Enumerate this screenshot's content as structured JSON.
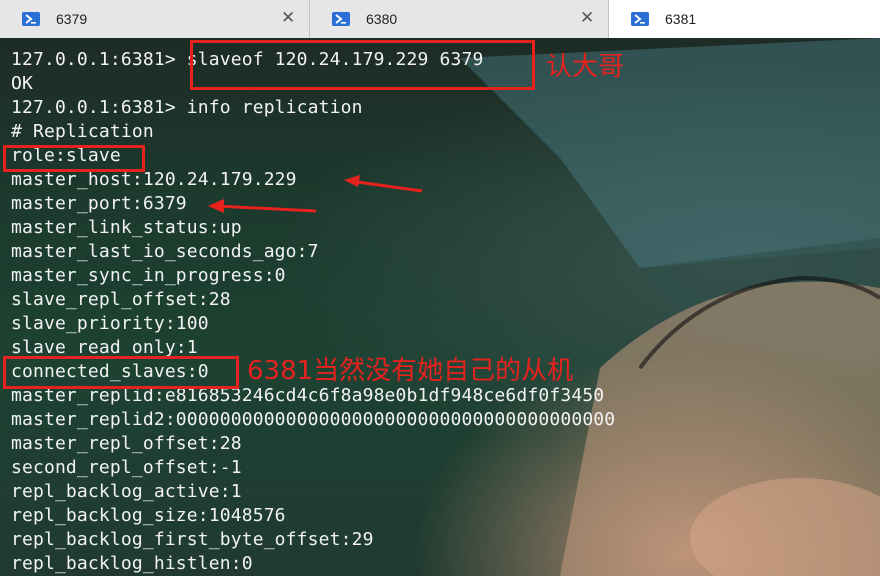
{
  "tabs": [
    {
      "label": "6379",
      "icon": "powershell-icon",
      "active": false
    },
    {
      "label": "6380",
      "icon": "powershell-icon",
      "active": false
    },
    {
      "label": "6381",
      "icon": "powershell-icon",
      "active": true
    }
  ],
  "terminal": {
    "lines": [
      "127.0.0.1:6381> slaveof 120.24.179.229 6379",
      "OK",
      "127.0.0.1:6381> info replication",
      "# Replication",
      "role:slave",
      "master_host:120.24.179.229",
      "master_port:6379",
      "master_link_status:up",
      "master_last_io_seconds_ago:7",
      "master_sync_in_progress:0",
      "slave_repl_offset:28",
      "slave_priority:100",
      "slave_read_only:1",
      "connected_slaves:0",
      "master_replid:e816853246cd4c6f8a98e0b1df948ce6df0f3450",
      "master_replid2:0000000000000000000000000000000000000000",
      "master_repl_offset:28",
      "second_repl_offset:-1",
      "repl_backlog_active:1",
      "repl_backlog_size:1048576",
      "repl_backlog_first_byte_offset:29",
      "repl_backlog_histlen:0"
    ]
  },
  "annotations": {
    "note1": "认大哥",
    "note2": "6381当然没有她自己的从机",
    "color": "#e5221e"
  }
}
